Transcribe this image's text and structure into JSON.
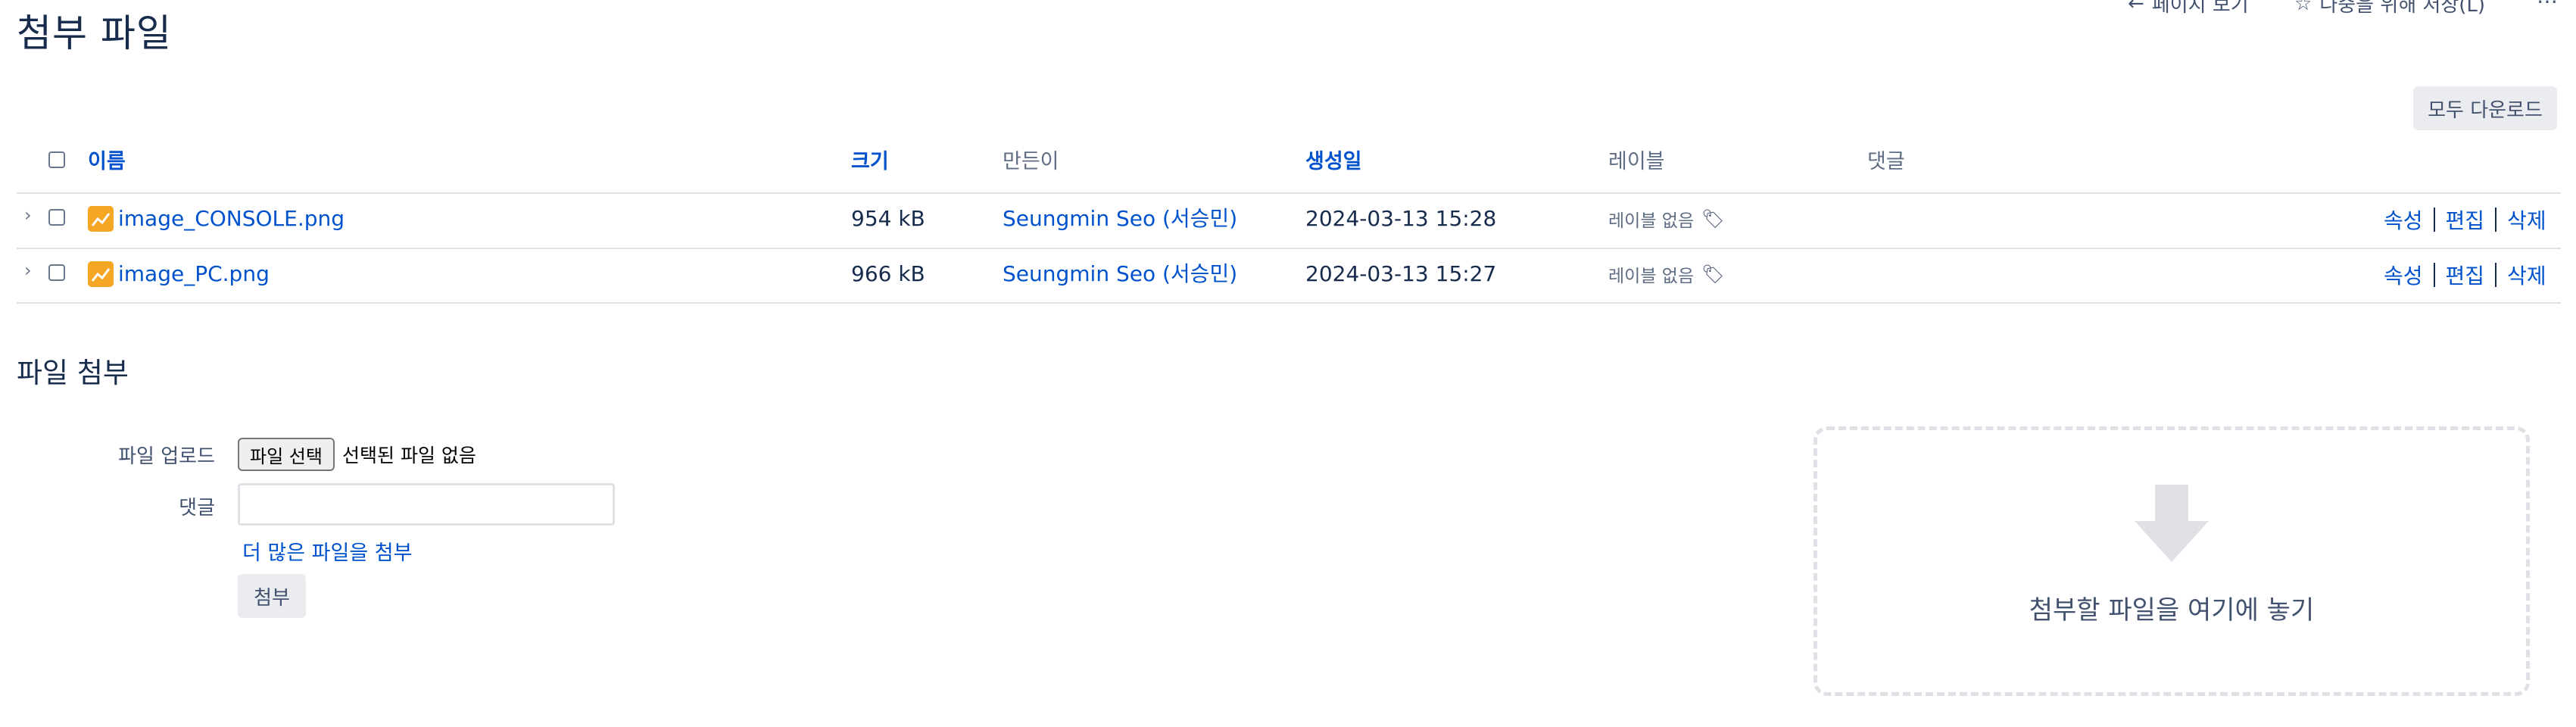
{
  "page": {
    "title": "첨부 파일",
    "top_actions": [
      {
        "label": "페이지 보기",
        "icon": "arrow-left-icon"
      },
      {
        "label": "나중을 위해 저장(L)",
        "icon": "star-icon"
      }
    ],
    "more_label": "…"
  },
  "toolbar": {
    "download_all_label": "모두 다운로드"
  },
  "table": {
    "columns": [
      "이름",
      "크기",
      "만든이",
      "생성일",
      "레이블",
      "댓글"
    ],
    "rows": [
      {
        "name": "image_CONSOLE.png",
        "size": "954 kB",
        "creator": "Seungmin Seo (서승민)",
        "created": "2024-03-13 15:28",
        "label": "레이블 없음",
        "comment": "",
        "actions": [
          "속성",
          "편집",
          "삭제"
        ]
      },
      {
        "name": "image_PC.png",
        "size": "966 kB",
        "creator": "Seungmin Seo (서승민)",
        "created": "2024-03-13 15:27",
        "label": "레이블 없음",
        "comment": "",
        "actions": [
          "속성",
          "편집",
          "삭제"
        ]
      }
    ]
  },
  "attach_section": {
    "title": "파일 첨부",
    "upload_label": "파일 업로드",
    "file_select_button": "파일 선택",
    "no_file_text": "선택된 파일 없음",
    "comment_label": "댓글",
    "comment_value": "",
    "attach_more_link": "더 많은 파일을 첨부",
    "attach_button": "첨부",
    "drop_zone_text": "첨부할 파일을 여기에 놓기"
  },
  "colors": {
    "link": "#0052cc",
    "text": "#172b4d",
    "file_icon": "#f5a623",
    "arrow": "#dfe1e6"
  }
}
